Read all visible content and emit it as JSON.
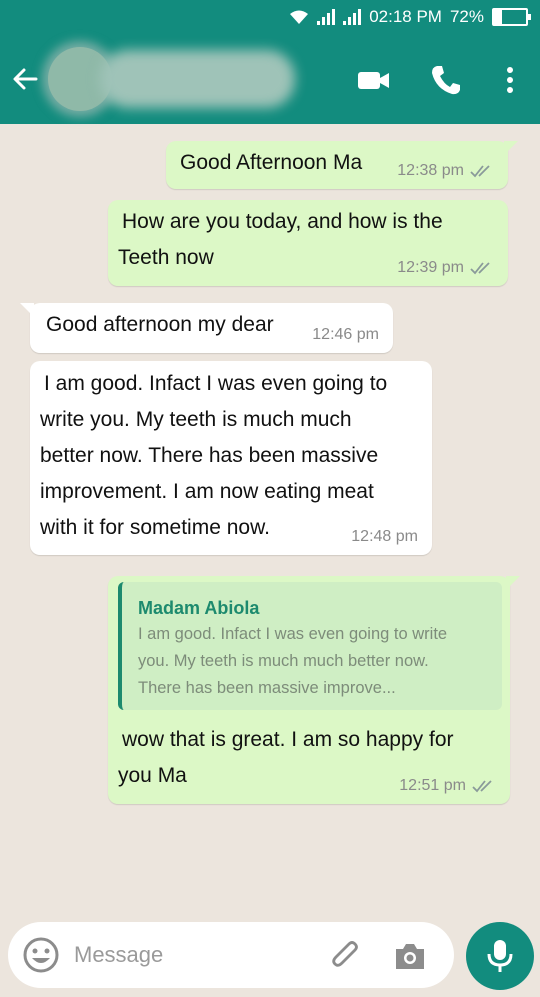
{
  "status_bar": {
    "time": "02:18 PM",
    "battery": "72%"
  },
  "header": {
    "back_icon": "arrow-left-icon",
    "video_icon": "video-camera-icon",
    "call_icon": "phone-icon",
    "menu_icon": "more-vertical-icon"
  },
  "messages": [
    {
      "direction": "outgoing",
      "lines": [
        "Good Afternoon Ma"
      ],
      "time": "12:38 pm",
      "status": "read"
    },
    {
      "direction": "outgoing",
      "lines": [
        "How are you today, and how is the",
        "Teeth now"
      ],
      "time": "12:39 pm",
      "status": "read"
    },
    {
      "direction": "incoming",
      "lines": [
        "Good afternoon my dear"
      ],
      "time": "12:46 pm"
    },
    {
      "direction": "incoming",
      "lines": [
        "I am good. Infact I was even going to",
        "write you. My teeth is much much",
        "better now. There has been massive",
        "improvement. I am now eating meat",
        "with it for sometime now."
      ],
      "time": "12:48 pm"
    },
    {
      "direction": "outgoing",
      "quote": {
        "author": "Madam Abiola",
        "lines": [
          "I am good. Infact I was even going to write",
          "you. My teeth is much much better now.",
          "There has been massive improve..."
        ]
      },
      "lines": [
        "wow that is great. I am so happy for",
        "you Ma"
      ],
      "time": "12:51 pm",
      "status": "read"
    }
  ],
  "composer": {
    "placeholder": "Message",
    "emoji_icon": "emoji-icon",
    "attach_icon": "paperclip-icon",
    "camera_icon": "camera-icon",
    "mic_icon": "microphone-icon"
  },
  "colors": {
    "header": "#128c7e",
    "chat_background": "#ece5dd",
    "outgoing_bubble": "#dcf8c6",
    "incoming_bubble": "#ffffff",
    "quote_accent": "#1d8a6e"
  }
}
